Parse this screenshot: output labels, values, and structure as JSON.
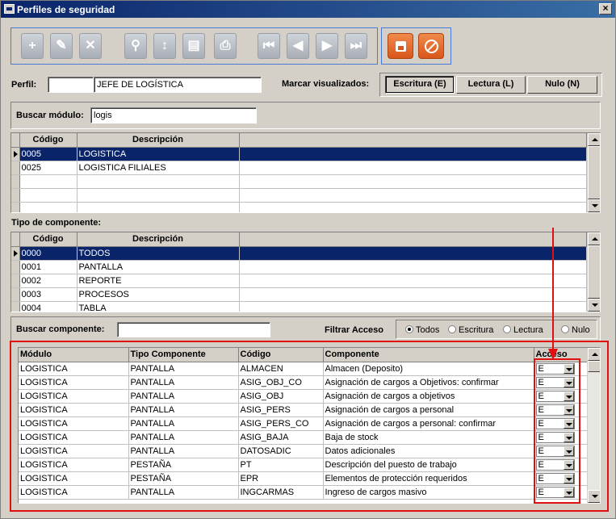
{
  "window": {
    "title": "Perfiles de seguridad",
    "close_label": "×"
  },
  "toolbar": {
    "nav_icons": [
      "add-icon",
      "edit-icon",
      "delete-icon",
      "search-icon",
      "sort-icon",
      "report-icon",
      "print-icon",
      "first-icon",
      "prev-icon",
      "next-icon",
      "last-icon"
    ],
    "glyphs": [
      "+",
      "✎",
      "✕",
      "⚲",
      "↕",
      "▤",
      "⎙",
      "⏮",
      "◀",
      "▶",
      "⏭"
    ],
    "action_icons": [
      "save-icon",
      "cancel-icon"
    ]
  },
  "perfil": {
    "label": "Perfil:",
    "code": "",
    "name": "JEFE DE LOGÍSTICA"
  },
  "marcar": {
    "label": "Marcar visualizados:",
    "buttons": [
      "Escritura (E)",
      "Lectura (L)",
      "Nulo (N)"
    ]
  },
  "modulo_search": {
    "label": "Buscar módulo:",
    "value": "logis"
  },
  "modulos": {
    "columns": [
      "Código",
      "Descripción"
    ],
    "rows": [
      [
        "0005",
        "LOGISTICA"
      ],
      [
        "0025",
        "LOGISTICA FILIALES"
      ],
      [
        "",
        ""
      ],
      [
        "",
        ""
      ],
      [
        "",
        ""
      ]
    ]
  },
  "tipo": {
    "label": "Tipo de componente:",
    "columns": [
      "Código",
      "Descripción"
    ],
    "rows": [
      [
        "0000",
        "TODOS"
      ],
      [
        "0001",
        "PANTALLA"
      ],
      [
        "0002",
        "REPORTE"
      ],
      [
        "0003",
        "PROCESOS"
      ],
      [
        "0004",
        "TABLA"
      ]
    ]
  },
  "componente_search": {
    "label": "Buscar componente:",
    "value": ""
  },
  "filtro": {
    "label": "Filtrar Acceso",
    "options": [
      "Todos",
      "Escritura",
      "Lectura",
      "Nulo"
    ],
    "selected": "Todos"
  },
  "componentes": {
    "columns": [
      "Módulo",
      "Tipo Componente",
      "Código",
      "Componente",
      "Acceso"
    ],
    "rows": [
      [
        "LOGISTICA",
        "PANTALLA",
        "ALMACEN",
        "Almacen (Deposito)",
        "E"
      ],
      [
        "LOGISTICA",
        "PANTALLA",
        "ASIG_OBJ_CO",
        "Asignación de cargos a Objetivos: confirmar",
        "E"
      ],
      [
        "LOGISTICA",
        "PANTALLA",
        "ASIG_OBJ",
        "Asignación de cargos a objetivos",
        "E"
      ],
      [
        "LOGISTICA",
        "PANTALLA",
        "ASIG_PERS",
        "Asignación de cargos a personal",
        "E"
      ],
      [
        "LOGISTICA",
        "PANTALLA",
        "ASIG_PERS_CO",
        "Asignación de cargos a personal: confirmar",
        "E"
      ],
      [
        "LOGISTICA",
        "PANTALLA",
        "ASIG_BAJA",
        "Baja de stock",
        "E"
      ],
      [
        "LOGISTICA",
        "PANTALLA",
        "DATOSADIC",
        "Datos adicionales",
        "E"
      ],
      [
        "LOGISTICA",
        "PESTAÑA",
        "PT",
        "Descripción del puesto de trabajo",
        "E"
      ],
      [
        "LOGISTICA",
        "PESTAÑA",
        "EPR",
        "Elementos de protección requeridos",
        "E"
      ],
      [
        "LOGISTICA",
        "PANTALLA",
        "INGCARMAS",
        "Ingreso de cargos masivo",
        "E"
      ]
    ]
  },
  "colors": {
    "selection": "#0a246a",
    "annotation": "#e01010",
    "action_button": "#d9561a"
  }
}
